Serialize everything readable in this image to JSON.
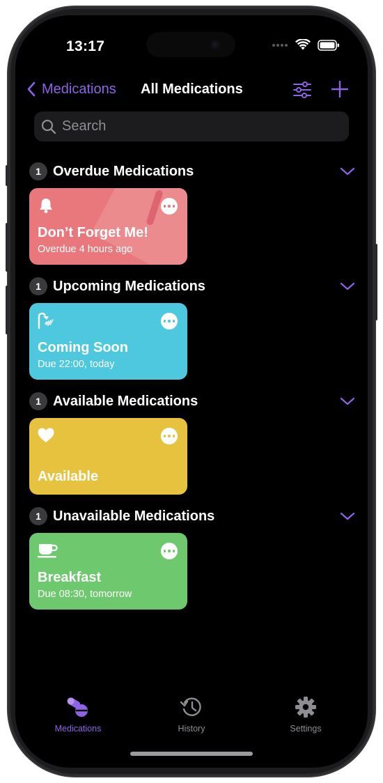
{
  "status_bar": {
    "time": "13:17"
  },
  "nav": {
    "back_label": "Medications",
    "title": "All Medications"
  },
  "search": {
    "placeholder": "Search"
  },
  "sections": [
    {
      "count": "1",
      "title": "Overdue Medications",
      "card": {
        "name": "Don’t Forget Me!",
        "detail": "Overdue 4 hours ago",
        "color": "#e8787c",
        "icon": "bell-icon"
      }
    },
    {
      "count": "1",
      "title": "Upcoming Medications",
      "card": {
        "name": "Coming Soon",
        "detail": "Due 22:00, today",
        "color": "#4ec8de",
        "icon": "shower-icon"
      }
    },
    {
      "count": "1",
      "title": "Available Medications",
      "card": {
        "name": "Available",
        "detail": "",
        "color": "#e6c23f",
        "icon": "heart-icon"
      }
    },
    {
      "count": "1",
      "title": "Unavailable Medications",
      "card": {
        "name": "Breakfast",
        "detail": "Due 08:30, tomorrow",
        "color": "#6ec96e",
        "icon": "cup-icon"
      }
    }
  ],
  "tabs": [
    {
      "label": "Medications",
      "icon": "pills-icon",
      "active": true
    },
    {
      "label": "History",
      "icon": "history-icon",
      "active": false
    },
    {
      "label": "Settings",
      "icon": "gear-icon",
      "active": false
    }
  ],
  "colors": {
    "accent": "#8f63e6",
    "inactive_tab": "#8d8d93",
    "overdue": "#e8787c",
    "upcoming": "#4ec8de",
    "available": "#e6c23f",
    "unavailable": "#6ec96e"
  }
}
